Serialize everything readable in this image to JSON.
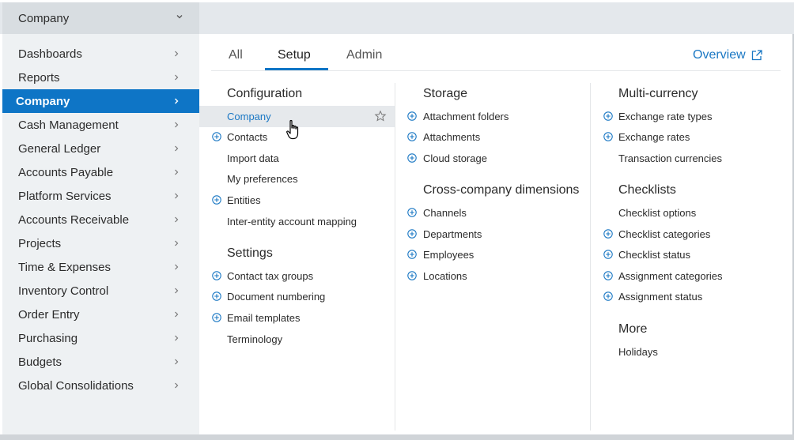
{
  "topbar": {
    "dropdown_label": "Company"
  },
  "sidebar": {
    "items": [
      {
        "label": "Dashboards"
      },
      {
        "label": "Reports"
      },
      {
        "label": "Company"
      },
      {
        "label": "Cash Management"
      },
      {
        "label": "General Ledger"
      },
      {
        "label": "Accounts Payable"
      },
      {
        "label": "Platform Services"
      },
      {
        "label": "Accounts Receivable"
      },
      {
        "label": "Projects"
      },
      {
        "label": "Time & Expenses"
      },
      {
        "label": "Inventory Control"
      },
      {
        "label": "Order Entry"
      },
      {
        "label": "Purchasing"
      },
      {
        "label": "Budgets"
      },
      {
        "label": "Global Consolidations"
      }
    ],
    "active_item": "Company"
  },
  "tabs": {
    "all": "All",
    "setup": "Setup",
    "admin": "Admin",
    "active": "Setup"
  },
  "overview_link": "Overview",
  "col1": {
    "configuration_heading": "Configuration",
    "company": "Company",
    "contacts": "Contacts",
    "import_data": "Import data",
    "my_preferences": "My preferences",
    "entities": "Entities",
    "inter_entity": "Inter-entity account mapping",
    "settings_heading": "Settings",
    "contact_tax_groups": "Contact tax groups",
    "document_numbering": "Document numbering",
    "email_templates": "Email templates",
    "terminology": "Terminology"
  },
  "col2": {
    "storage_heading": "Storage",
    "attachment_folders": "Attachment folders",
    "attachments": "Attachments",
    "cloud_storage": "Cloud storage",
    "cross_company_heading": "Cross-company dimensions",
    "channels": "Channels",
    "departments": "Departments",
    "employees": "Employees",
    "locations": "Locations"
  },
  "col3": {
    "multi_currency_heading": "Multi-currency",
    "exchange_rate_types": "Exchange rate types",
    "exchange_rates": "Exchange rates",
    "transaction_currencies": "Transaction currencies",
    "checklists_heading": "Checklists",
    "checklist_options": "Checklist options",
    "checklist_categories": "Checklist categories",
    "checklist_status": "Checklist status",
    "assignment_categories": "Assignment categories",
    "assignment_status": "Assignment status",
    "more_heading": "More",
    "holidays": "Holidays"
  },
  "colors": {
    "accent": "#0e75c6",
    "link": "#1b78c4",
    "sidebar_bg": "#eef1f3"
  },
  "icons": {
    "chevron": "chevron-right-icon",
    "plus": "plus-circle-icon",
    "star": "star-outline-icon",
    "external": "external-link-icon",
    "cursor": "hand-pointer-icon"
  }
}
